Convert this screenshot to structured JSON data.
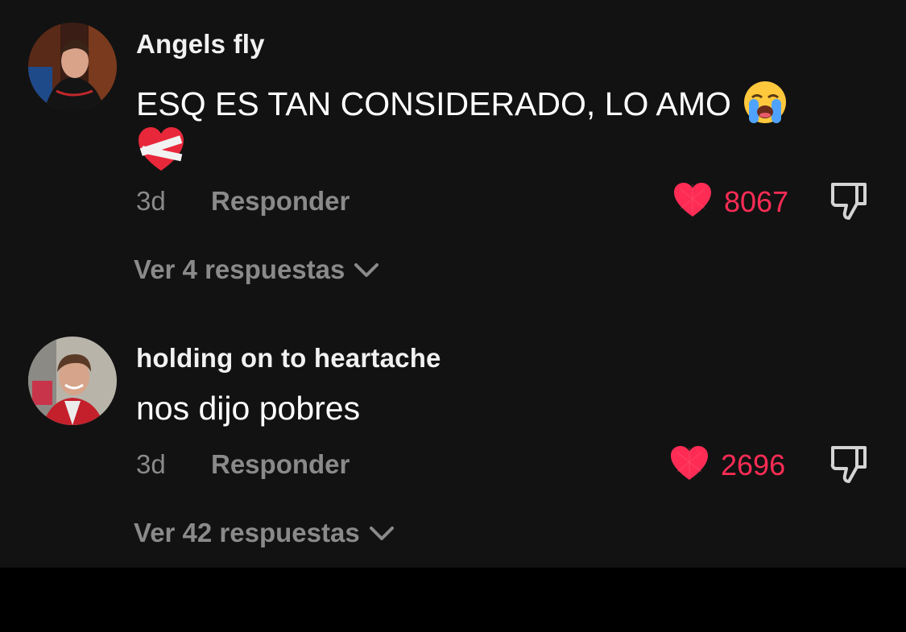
{
  "comments": [
    {
      "username": "Angels fly",
      "text": "ESQ ES TAN CONSIDERADO, LO AMO",
      "emojis": [
        "loudly-crying-face-emoji",
        "mending-heart-emoji"
      ],
      "time": "3d",
      "reply_label": "Responder",
      "likes": "8067",
      "liked": true,
      "view_replies": "Ver 4 respuestas"
    },
    {
      "username": "holding on to heartache",
      "text": "nos dijo pobres",
      "emojis": [],
      "time": "3d",
      "reply_label": "Responder",
      "likes": "2696",
      "liked": true,
      "view_replies": "Ver 42 respuestas"
    }
  ],
  "colors": {
    "background": "#121212",
    "like_accent": "#fe2c55",
    "secondary_text": "#8a8a8a"
  }
}
